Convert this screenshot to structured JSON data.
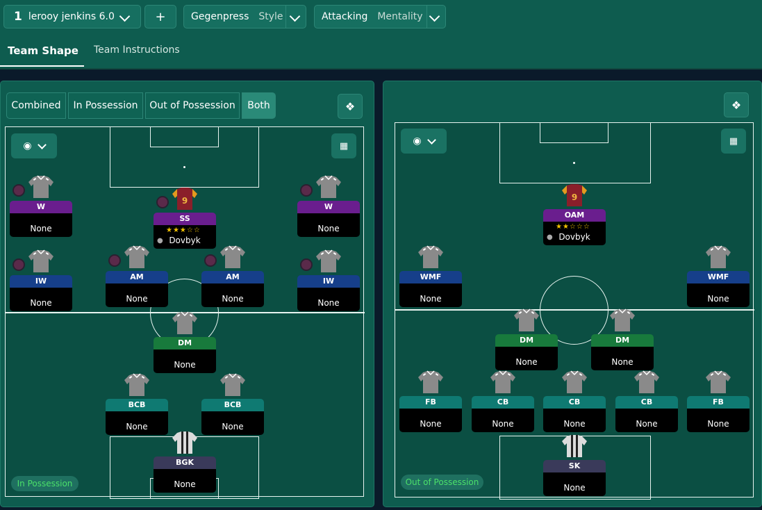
{
  "header": {
    "tactic_number": "1",
    "tactic_name": "lerooy jenkins 6.0",
    "add_label": "+",
    "style_value": "Gegenpress",
    "style_label": "Style",
    "mentality_value": "Attacking",
    "mentality_label": "Mentality"
  },
  "tabs": [
    "Team Shape",
    "Team Instructions"
  ],
  "view_modes": [
    "Combined",
    "In Possession",
    "Out of Possession",
    "Both"
  ],
  "active_view_mode": "Both",
  "left_panel": {
    "mode_label": "In Possession",
    "positions": [
      {
        "role": "W",
        "player": "None",
        "color": "#6a1e8e"
      },
      {
        "role": "SS",
        "player": "Dovbyk",
        "color": "#6a1e8e",
        "stars": "★★★☆☆"
      },
      {
        "role": "W",
        "player": "None",
        "color": "#6a1e8e"
      },
      {
        "role": "IW",
        "player": "None",
        "color": "#163f8a"
      },
      {
        "role": "AM",
        "player": "None",
        "color": "#163f8a"
      },
      {
        "role": "AM",
        "player": "None",
        "color": "#163f8a"
      },
      {
        "role": "IW",
        "player": "None",
        "color": "#163f8a"
      },
      {
        "role": "DM",
        "player": "None",
        "color": "#187a3c"
      },
      {
        "role": "BCB",
        "player": "None",
        "color": "#0f7a72"
      },
      {
        "role": "BCB",
        "player": "None",
        "color": "#0f7a72"
      },
      {
        "role": "BGK",
        "player": "None",
        "color": "#3a3a5a"
      }
    ]
  },
  "right_panel": {
    "mode_label": "Out of Possession",
    "positions": [
      {
        "role": "OAM",
        "player": "Dovbyk",
        "color": "#6a1e8e",
        "stars": "★★☆☆☆"
      },
      {
        "role": "WMF",
        "player": "None",
        "color": "#163f8a"
      },
      {
        "role": "WMF",
        "player": "None",
        "color": "#163f8a"
      },
      {
        "role": "DM",
        "player": "None",
        "color": "#187a3c"
      },
      {
        "role": "DM",
        "player": "None",
        "color": "#187a3c"
      },
      {
        "role": "FB",
        "player": "None",
        "color": "#0f7a72"
      },
      {
        "role": "CB",
        "player": "None",
        "color": "#0f7a72"
      },
      {
        "role": "CB",
        "player": "None",
        "color": "#0f7a72"
      },
      {
        "role": "CB",
        "player": "None",
        "color": "#0f7a72"
      },
      {
        "role": "FB",
        "player": "None",
        "color": "#0f7a72"
      },
      {
        "role": "SK",
        "player": "None",
        "color": "#3a3a5a"
      }
    ]
  },
  "icons": {
    "eye": "eye-icon",
    "grid": "grid-icon",
    "rotate": "rotate-pitch-icon"
  }
}
